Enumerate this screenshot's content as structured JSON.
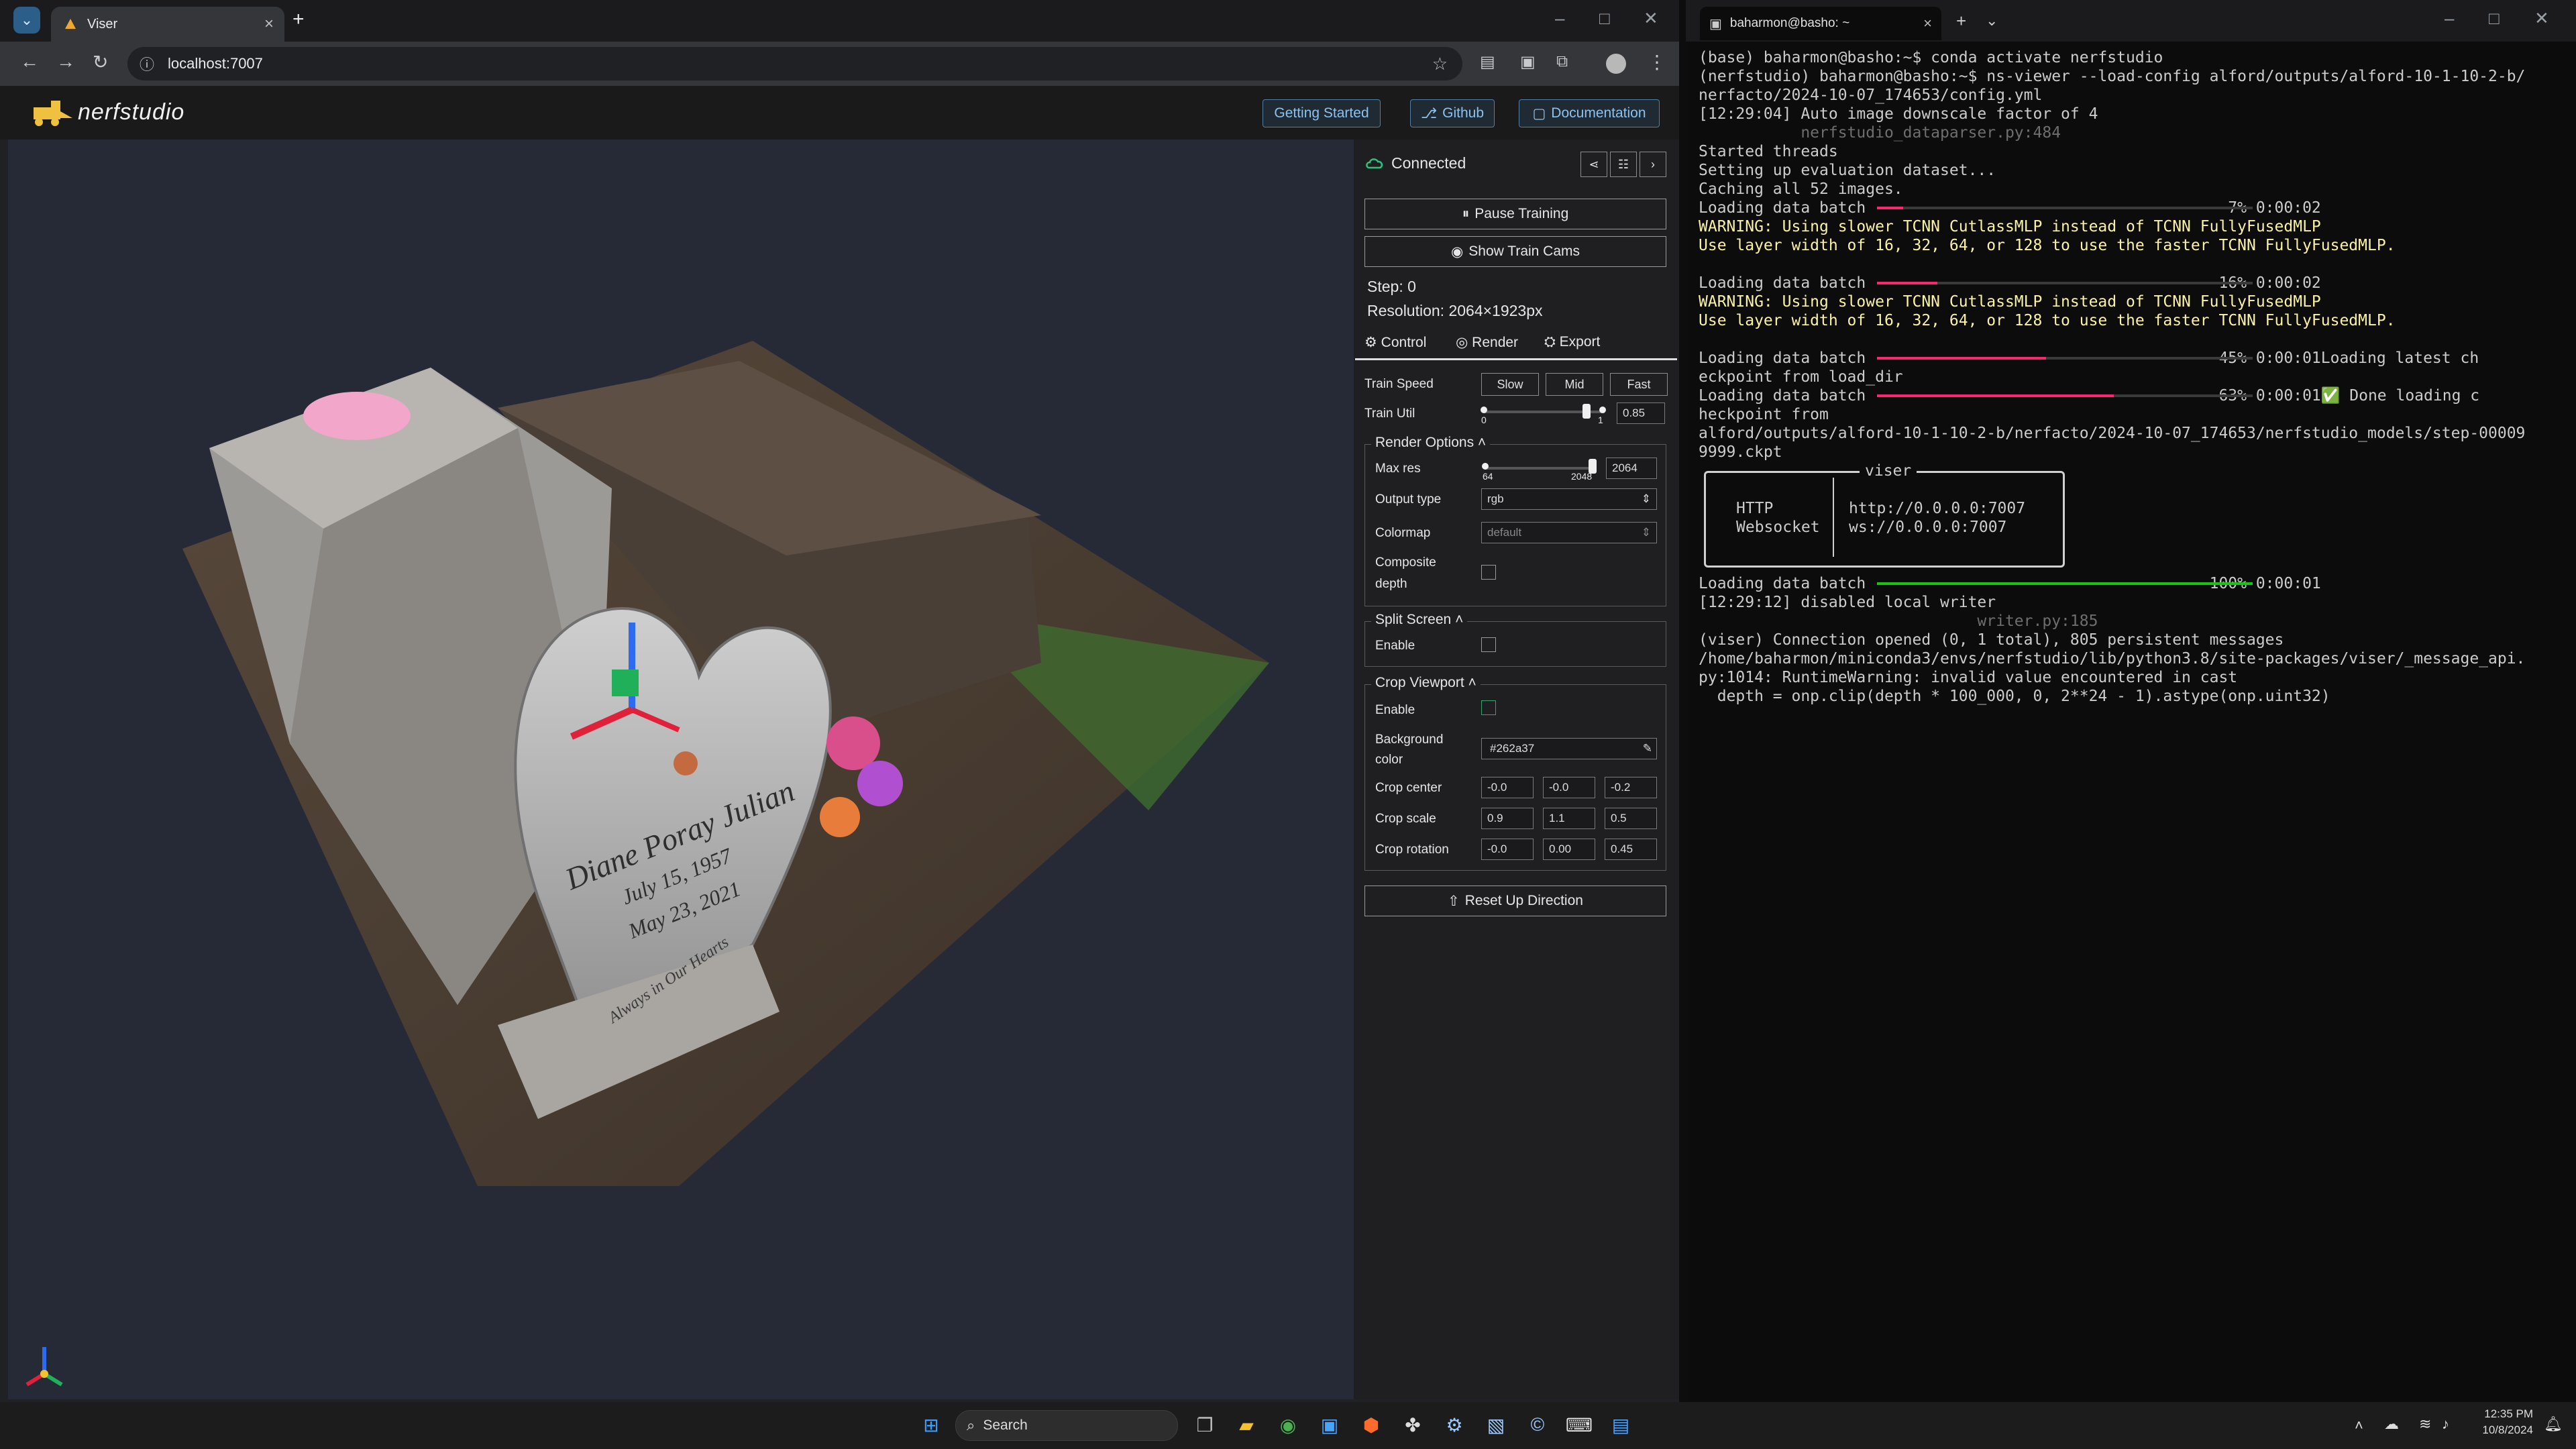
{
  "browser": {
    "tab_title": "Viser",
    "tab_close": "×",
    "new_tab": "+",
    "url": "localhost:7007",
    "window_controls": [
      "–",
      "□",
      "✕"
    ]
  },
  "nerfstudio": {
    "logo": "nerfstudio",
    "header_buttons": [
      "Getting Started",
      "Github",
      "Documentation"
    ],
    "connection": "Connected",
    "pause_training": "Pause Training",
    "show_train_cams": "Show Train Cams",
    "step": "Step: 0",
    "resolution": "Resolution: 2064×1923px",
    "tabs": [
      "Control",
      "Render",
      "Export"
    ],
    "train_speed_label": "Train Speed",
    "speed_buttons": [
      "Slow",
      "Mid",
      "Fast"
    ],
    "train_util_label": "Train Util",
    "train_util_min": "0",
    "train_util_max": "1",
    "train_util_value": "0.85",
    "render_options_title": "Render Options",
    "max_res_label": "Max res",
    "max_res_min": "64",
    "max_res_max": "2048",
    "max_res_value": "2064",
    "output_type_label": "Output type",
    "output_type_value": "rgb",
    "colormap_label": "Colormap",
    "colormap_value": "default",
    "composite_depth_label_1": "Composite",
    "composite_depth_label_2": "depth",
    "split_screen_title": "Split Screen",
    "enable_label": "Enable",
    "crop_viewport_title": "Crop Viewport",
    "background_color_label_1": "Background",
    "background_color_label_2": "color",
    "background_color_value": "#262a37",
    "crop_center_label": "Crop center",
    "crop_center_values": [
      "-0.0",
      "-0.0",
      "-0.2"
    ],
    "crop_scale_label": "Crop scale",
    "crop_scale_values": [
      "0.9",
      "1.1",
      "0.5"
    ],
    "crop_rotation_label": "Crop rotation",
    "crop_rotation_values": [
      "-0.0",
      "0.00",
      "0.45"
    ],
    "reset_up_direction": "Reset Up Direction",
    "train_util_fraction": 0.85,
    "max_res_fraction": 1.0
  },
  "scene": {
    "headstone_name": "Diane Poray Julian",
    "date_1": "July 15, 1957",
    "date_2": "May 23, 2021",
    "epitaph": "Always in Our Hearts"
  },
  "terminal": {
    "tab_title": "baharmon@basho: ~",
    "lines": [
      "(base) baharmon@basho:~$ conda activate nerfstudio",
      "(nerfstudio) baharmon@basho:~$ ns-viewer --load-config alford/outputs/alford-10-1-10-2-b/",
      "nerfacto/2024-10-07_174653/config.yml",
      "[12:29:04] Auto image downscale factor of 4",
      "           nerfstudio_dataparser.py:484",
      "Started threads",
      "Setting up evaluation dataset...",
      "Caching all 52 images.",
      "Loading data batch                                       7% 0:00:02",
      "WARNING: Using slower TCNN CutlassMLP instead of TCNN FullyFusedMLP",
      "Use layer width of 16, 32, 64, or 128 to use the faster TCNN FullyFusedMLP.",
      "",
      "Loading data batch                                      16% 0:00:02",
      "WARNING: Using slower TCNN CutlassMLP instead of TCNN FullyFusedMLP",
      "Use layer width of 16, 32, 64, or 128 to use the faster TCNN FullyFusedMLP.",
      "",
      "Loading data batch                                      45% 0:00:01Loading latest ch",
      "eckpoint from load_dir",
      "Loading data batch                                      63% 0:00:01✅ Done loading c",
      "heckpoint from",
      "alford/outputs/alford-10-1-10-2-b/nerfacto/2024-10-07_174653/nerfstudio_models/step-00009",
      "9999.ckpt"
    ],
    "viser_box_title": "viser",
    "viser_http_label": "HTTP",
    "viser_http_value": "http://0.0.0.0:7007",
    "viser_ws_label": "Websocket",
    "viser_ws_value": "ws://0.0.0.0:7007",
    "lines_after": [
      "Loading data batch                                     100% 0:00:01",
      "[12:29:12] disabled local writer",
      "                              writer.py:185",
      "(viser) Connection opened (0, 1 total), 805 persistent messages",
      "/home/baharmon/miniconda3/envs/nerfstudio/lib/python3.8/site-packages/viser/_message_api.",
      "py:1014: RuntimeWarning: invalid value encountered in cast",
      "  depth = onp.clip(depth * 100_000, 0, 2**24 - 1).astype(onp.uint32)"
    ],
    "progress": [
      0.07,
      0.16,
      0.45,
      0.63,
      1.0
    ]
  },
  "taskbar": {
    "search_placeholder": "Search",
    "time": "12:35 PM",
    "date": "10/8/2024"
  },
  "colors": {
    "accent": "#8cc2f0",
    "viewport_bg": "#262a37",
    "progress": "#f92672",
    "progress_done": "#16c60c"
  }
}
